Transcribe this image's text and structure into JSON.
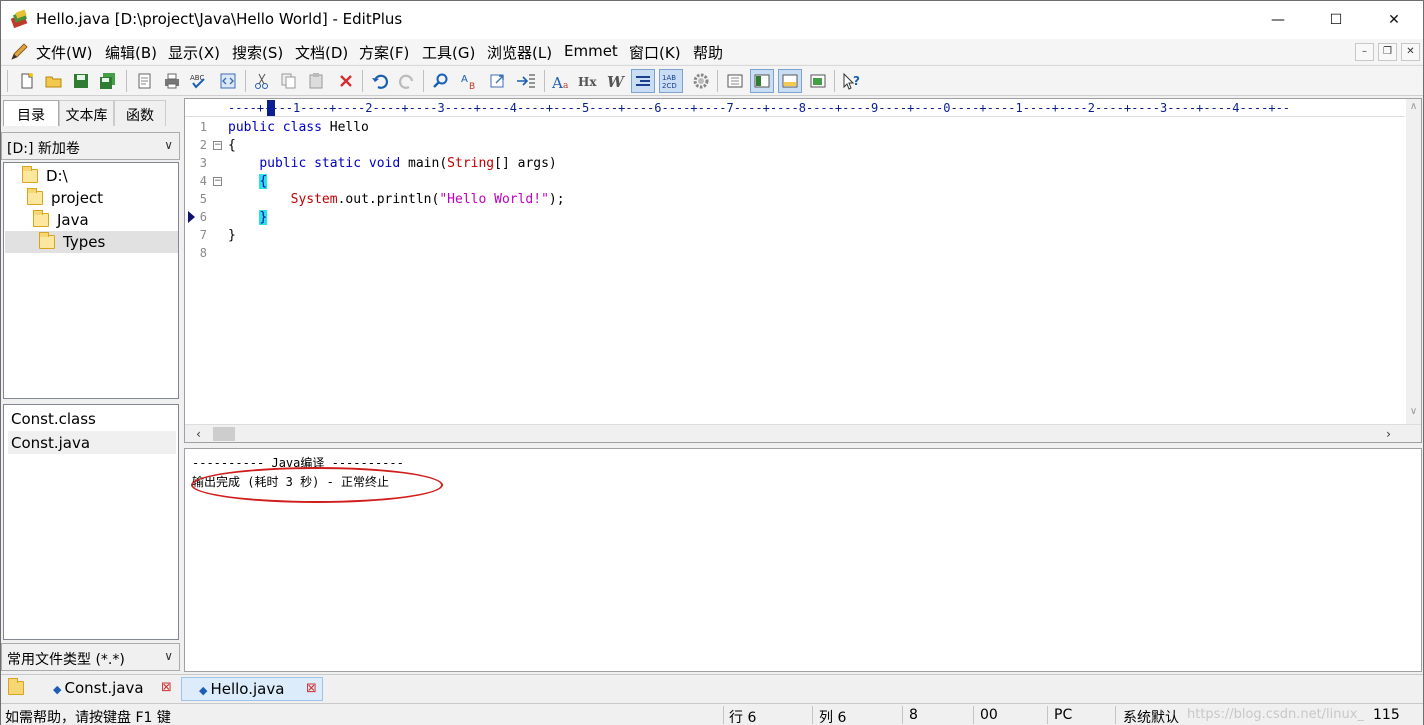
{
  "window": {
    "title": "Hello.java [D:\\project\\Java\\Hello World] - EditPlus",
    "controls": {
      "minimize": "—",
      "maximize": "☐",
      "close": "✕"
    }
  },
  "menu": {
    "items": [
      "文件(W)",
      "编辑(B)",
      "显示(X)",
      "搜索(S)",
      "文档(D)",
      "方案(F)",
      "工具(G)",
      "浏览器(L)",
      "Emmet",
      "窗口(K)",
      "帮助"
    ],
    "mdi": {
      "minimize": "–",
      "restore": "❐",
      "close": "✕"
    }
  },
  "toolbar": {
    "icons": [
      "new-file-icon",
      "open-folder-icon",
      "save-icon",
      "save-all-icon",
      "print-preview-icon",
      "print-icon",
      "spell-check-icon",
      "browser-preview-icon",
      "cut-icon",
      "copy-icon",
      "paste-icon",
      "delete-icon",
      "undo-icon",
      "redo-icon",
      "find-icon",
      "replace-icon",
      "goto-icon",
      "indent-icon",
      "font-icon",
      "hex-icon",
      "word-wrap-icon",
      "line-number-icon",
      "column-icon",
      "settings-gear-icon",
      "directory-window-icon",
      "output-window-icon",
      "cliptext-icon",
      "fullscreen-icon",
      "help-icon"
    ]
  },
  "left_panel": {
    "tabs": [
      "目录",
      "文本库",
      "函数"
    ],
    "drive": "[D:] 新加卷",
    "tree": [
      "D:\\",
      "project",
      "Java",
      "Types"
    ],
    "files": [
      "Const.class",
      "Const.java"
    ],
    "filter": "常用文件类型 (*.*)"
  },
  "editor": {
    "ruler": "----+----1----+----2----+----3----+----4----+----5----+----6----+----7----+----8----+----9----+----0----+----1----+----2----+----3----+----4----+--",
    "line_numbers": [
      "1",
      "2",
      "3",
      "4",
      "5",
      "6",
      "7",
      "8"
    ],
    "code": {
      "l1_kw": "public class",
      "l1_rest": " Hello",
      "l2": "{",
      "l3_indent": "    ",
      "l3_kw": "public static void",
      "l3_name": " main(",
      "l3_type": "String",
      "l3_rest": "[] args)",
      "l4_indent": "    ",
      "l4_brace": "{",
      "l5_indent": "        ",
      "l5_call": "System",
      "l5_rest": ".out.println(",
      "l5_str": "\"Hello World!\"",
      "l5_end": ");",
      "l6_indent": "    ",
      "l6_brace": "}",
      "l7": "}"
    }
  },
  "output": {
    "header": "---------- Java编译 ----------",
    "result": "输出完成 (耗时 3 秒) - 正常终止"
  },
  "doc_tabs": [
    {
      "label": "Const.java"
    },
    {
      "label": "Hello.java"
    }
  ],
  "status": {
    "help": "如需帮助，请按键盘 F1 键",
    "row": "行 6",
    "col": "列 6",
    "lines": "8",
    "code": "00",
    "format": "PC",
    "encoding": "系统默认",
    "number": "115"
  },
  "watermark": "https://blog.csdn.net/linux_"
}
